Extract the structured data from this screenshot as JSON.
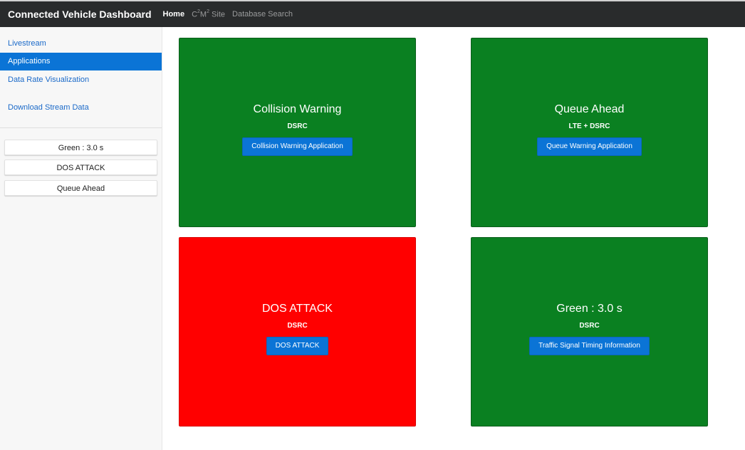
{
  "navbar": {
    "brand": "Connected Vehicle Dashboard",
    "links": [
      {
        "label": "Home",
        "active": true
      },
      {
        "label": "C",
        "sup1": "2",
        "mid": "M",
        "sup2": "2",
        "tail": " Site"
      },
      {
        "label": "Database Search"
      }
    ]
  },
  "sidebar": {
    "items": [
      {
        "label": "Livestream"
      },
      {
        "label": "Applications",
        "active": true
      },
      {
        "label": "Data Rate Visualization"
      },
      {
        "label": "Download Stream Data"
      }
    ],
    "status_buttons": [
      {
        "label": "Green : 3.0 s"
      },
      {
        "label": "DOS ATTACK"
      },
      {
        "label": "Queue Ahead"
      }
    ]
  },
  "cards": [
    {
      "title": "Collision Warning",
      "sub": "DSRC",
      "button": "Collision Warning Application",
      "color": "#0a8021"
    },
    {
      "title": "Queue Ahead",
      "sub": "LTE + DSRC",
      "button": "Queue Warning Application",
      "color": "#0a8021"
    },
    {
      "title": "DOS ATTACK",
      "sub": "DSRC",
      "button": "DOS ATTACK",
      "color": "#ff0000"
    },
    {
      "title": "Green : 3.0 s",
      "sub": "DSRC",
      "button": "Traffic Signal Timing Information",
      "color": "#0a8021"
    }
  ],
  "colors": {
    "navbar_bg": "#292b2c",
    "accent_blue": "#0b74d6",
    "status_green": "#0a8021",
    "status_red": "#ff0000"
  }
}
